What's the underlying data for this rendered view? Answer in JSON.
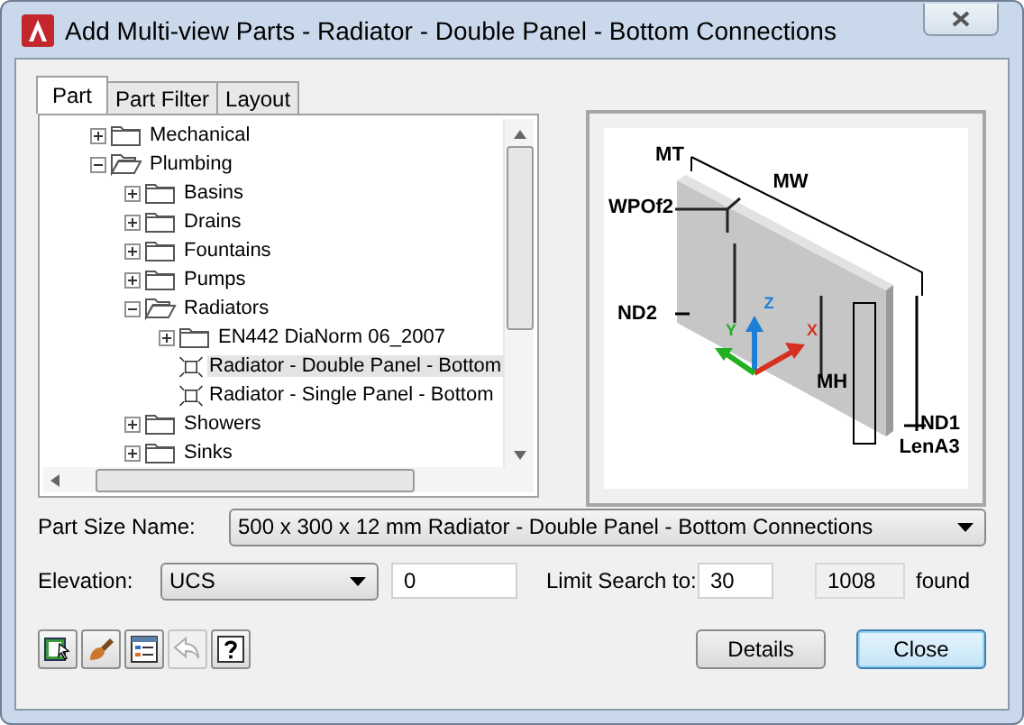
{
  "window": {
    "title": "Add Multi-view Parts - Radiator - Double Panel - Bottom Connections"
  },
  "tabs": [
    {
      "label": "Part",
      "selected": true
    },
    {
      "label": "Part Filter",
      "selected": false
    },
    {
      "label": "Layout",
      "selected": false
    }
  ],
  "tree": [
    {
      "label": "Mechanical",
      "kind": "folder",
      "expanded": false,
      "selected": false
    },
    {
      "label": "Plumbing",
      "kind": "folder",
      "expanded": true,
      "selected": false,
      "children": [
        {
          "label": "Basins",
          "kind": "folder",
          "expanded": false,
          "selected": false
        },
        {
          "label": "Drains",
          "kind": "folder",
          "expanded": false,
          "selected": false
        },
        {
          "label": "Fountains",
          "kind": "folder",
          "expanded": false,
          "selected": false
        },
        {
          "label": "Pumps",
          "kind": "folder",
          "expanded": false,
          "selected": false
        },
        {
          "label": "Radiators",
          "kind": "folder",
          "expanded": true,
          "selected": false,
          "children": [
            {
              "label": "EN442 DiaNorm 06_2007",
              "kind": "folder",
              "expanded": false,
              "selected": false
            },
            {
              "label": "Radiator - Double Panel - Bottom",
              "kind": "part",
              "selected": true
            },
            {
              "label": "Radiator - Single Panel - Bottom",
              "kind": "part",
              "selected": false
            }
          ]
        },
        {
          "label": "Showers",
          "kind": "folder",
          "expanded": false,
          "selected": false
        },
        {
          "label": "Sinks",
          "kind": "folder",
          "expanded": false,
          "selected": false
        }
      ]
    }
  ],
  "preview": {
    "labels": [
      "MT",
      "MW",
      "WPOf2",
      "ND2",
      "Z",
      "Y",
      "X",
      "MH",
      "ND1",
      "LenA3"
    ]
  },
  "part_size": {
    "label": "Part Size Name:",
    "value": "500 x 300 x 12 mm Radiator - Double Panel - Bottom Connections"
  },
  "elevation": {
    "label": "Elevation:",
    "mode": "UCS",
    "value": "0"
  },
  "limit_search": {
    "label": "Limit Search to:",
    "value": "30",
    "count": "1008",
    "suffix": "found"
  },
  "tool_buttons": [
    {
      "kind": "export",
      "disabled": false
    },
    {
      "kind": "brush",
      "disabled": false
    },
    {
      "kind": "list",
      "disabled": false
    },
    {
      "kind": "undo",
      "disabled": true
    },
    {
      "kind": "help",
      "disabled": false
    }
  ],
  "buttons": [
    {
      "label": "Details",
      "default": false
    },
    {
      "label": "Close",
      "default": true
    }
  ]
}
